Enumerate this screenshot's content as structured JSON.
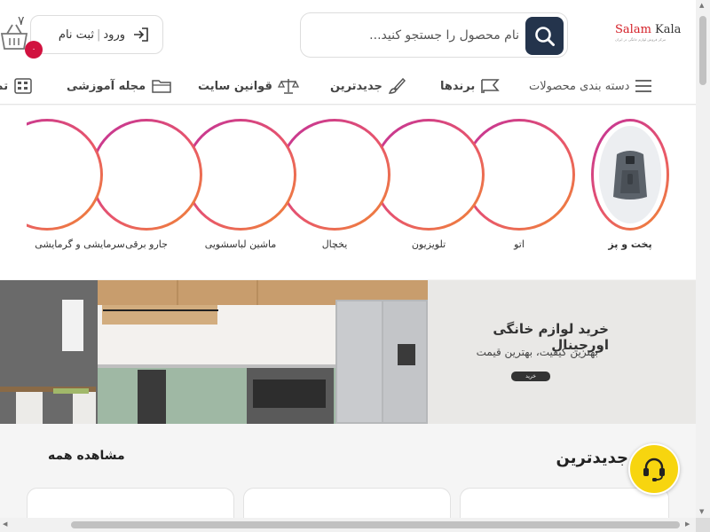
{
  "header": {
    "logo": {
      "prefix": "Salam",
      "suffix": " Kala",
      "tagline": "مرکز فروش لوازم خانگی در ایران"
    },
    "search": {
      "placeholder": "نام محصول را جستجو کنید..."
    },
    "login": {
      "login_label": "ورود",
      "separator": "|",
      "register_label": "ثبت نام"
    },
    "cart": {
      "count": "۰",
      "count_partial": "۷"
    }
  },
  "nav": {
    "categories_label": "دسته بندی محصولات",
    "brands_label": "برندها",
    "newest_label": "جدیدترین",
    "rules_label": "قوانین سایت",
    "magazine_label": "مجله آموزشی",
    "partial_label": "تم"
  },
  "categories": [
    {
      "label": "پخت و پز"
    },
    {
      "label": "اتو"
    },
    {
      "label": "تلویزیون"
    },
    {
      "label": "یخچال"
    },
    {
      "label": "ماشین لباسشویی"
    },
    {
      "label": "جارو برقی"
    },
    {
      "label": "سرمایشی و گرمایشی"
    }
  ],
  "banner": {
    "title": "خرید لوازم خانگی اورجینال",
    "subtitle": "بهترین کیفیت، بهترین قیمت",
    "button_label": "خرید"
  },
  "section": {
    "title": "جدیدترین",
    "view_all_label": "مشاهده همه"
  },
  "colors": {
    "accent_dark": "#24344c",
    "brand_red": "#d42028",
    "badge": "#d1123f",
    "support": "#f7d50f"
  }
}
